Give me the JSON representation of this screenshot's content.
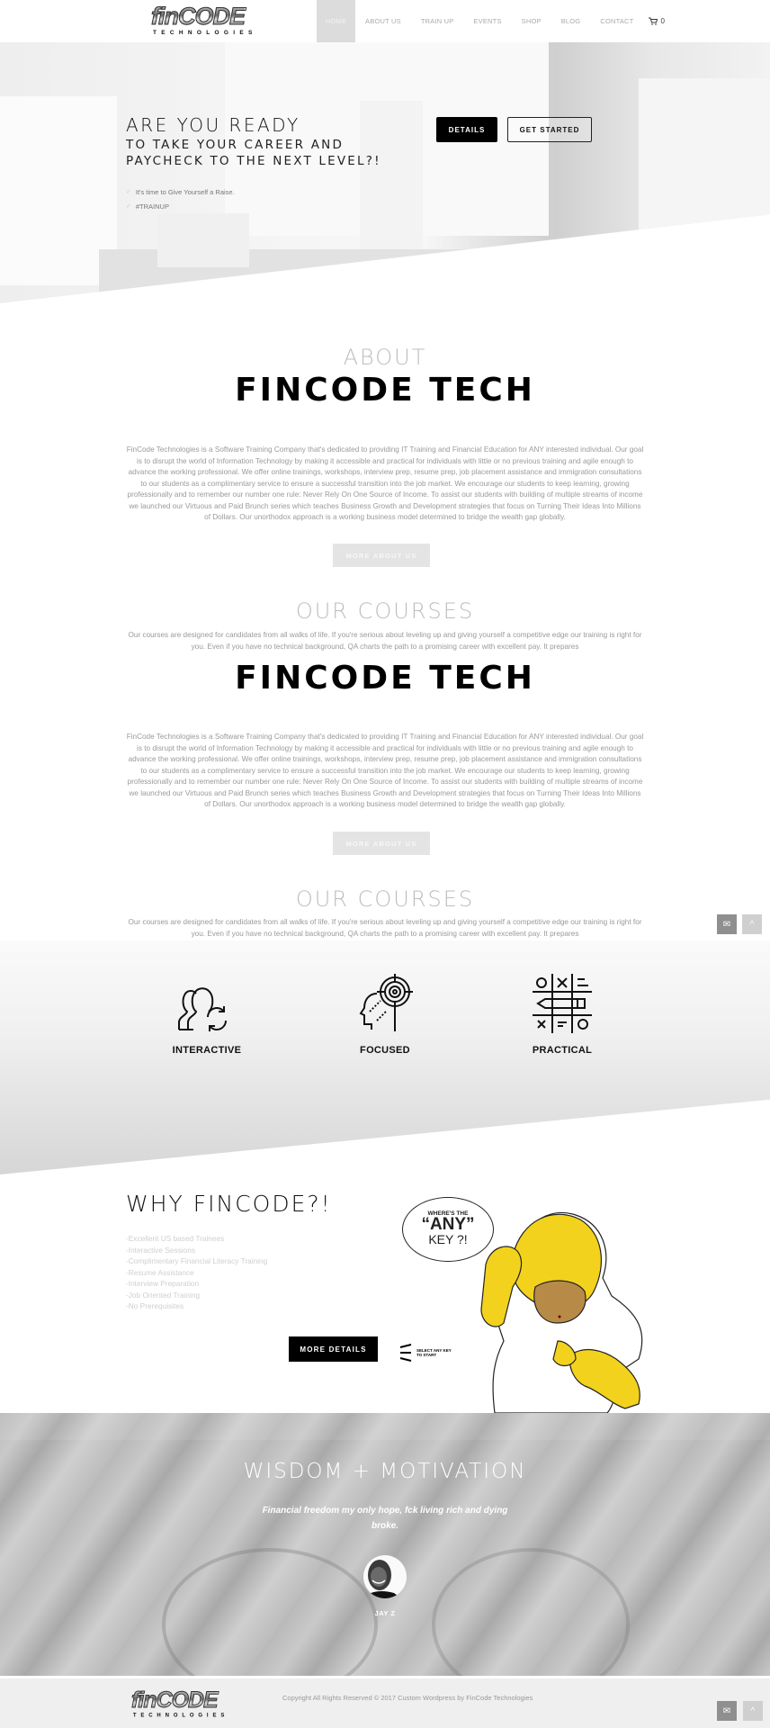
{
  "header": {
    "logo": {
      "word": "finCODE",
      "tagline": "TECHNOLOGIES"
    },
    "nav": [
      {
        "label": "HOME",
        "active": true
      },
      {
        "label": "ABOUT US"
      },
      {
        "label": "TRAIN UP"
      },
      {
        "label": "EVENTS"
      },
      {
        "label": "SHOP"
      },
      {
        "label": "BLOG"
      },
      {
        "label": "CONTACT"
      }
    ],
    "cart": {
      "icon": "cart-icon",
      "count": "0"
    }
  },
  "hero": {
    "title": "ARE YOU READY",
    "subtitle_line1": "TO TAKE YOUR CAREER AND",
    "subtitle_line2": "PAYCHECK TO THE NEXT LEVEL?!",
    "bullets": [
      "It's time to Give Yourself a Raise.",
      "#TRAINUP"
    ],
    "details_button": "DETAILS",
    "get_started_button": "GET STARTED"
  },
  "about": {
    "label": "ABOUT",
    "title": "FINCODE TECH",
    "paragraph": "FinCode Technologies is a Software Training Company that's dedicated to providing IT Training and Financial Education for ANY interested individual. Our goal is to disrupt the world of Information Technology by making it accessible and practical for individuals with little or no previous training and agile enough to advance the working professional. We offer online trainings, workshops, interview prep, resume prep, job placement assistance and immigration consultations to our students as a complimentary service to ensure a successful transition into the job market. We encourage our students to keep learning, growing professionally and to remember our number one rule: Never Rely On One Source of Income. To assist our students with building of multiple streams of income we launched our Virtuous and Paid Brunch series which teaches Business Growth and Development strategies that focus on Turning Their Ideas Into Millions of Dollars. Our unorthodox approach is a working business model determined to bridge the wealth gap globally.",
    "button": "MORE ABOUT US"
  },
  "courses": {
    "label": "OUR COURSES",
    "paragraph": "Our courses are designed for candidates from all walks of life. If you're serious about leveling up and giving yourself a competitive edge our training is right for you. Even if you have no technical background, QA charts the path to a promising career with excellent pay. It prepares"
  },
  "features": [
    {
      "label": "INTERACTIVE",
      "icon": "people-sync-icon"
    },
    {
      "label": "FOCUSED",
      "icon": "head-target-icon"
    },
    {
      "label": "PRACTICAL",
      "icon": "tic-tac-toe-pencil-icon"
    }
  ],
  "why": {
    "title": "WHY FINCODE?!",
    "items": [
      "-Excellent US based Trainees",
      "-Interactive Sessions",
      "-Complimentary Financial Literacy Training",
      "-Resume Assistance",
      "-Interview Preparation",
      "-Job Oriented Training",
      "-No Prerequisites"
    ],
    "button": "MORE DETAILS",
    "bubble": {
      "line1": "WHERE'S THE",
      "line2": "“ANY”",
      "line3": "KEY ?!"
    },
    "any_key_caption_1": "SELECT ANY KEY",
    "any_key_caption_2": "TO START"
  },
  "wisdom": {
    "title": "WISDOM + MOTIVATION",
    "quote": "Financial freedom my only hope, fck living rich and dying broke.",
    "author": "JAY Z"
  },
  "footer": {
    "copyright": "Copyright All Rights Reserved © 2017 Custom Wordpress by FinCode Technologies"
  },
  "floating": {
    "mail_icon": "✉",
    "top_icon": "^"
  },
  "colors": {
    "accent": "#000000",
    "muted_text": "#9a9a9a",
    "label_gray": "#bdbdbd",
    "nav_active_bg": "#dcdcdc"
  }
}
